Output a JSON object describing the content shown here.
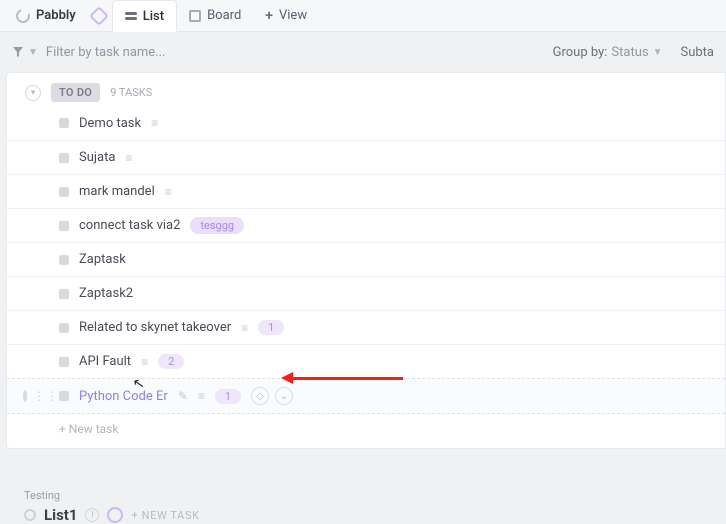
{
  "brand": "Pabbly",
  "tabs": {
    "list": "List",
    "board": "Board",
    "view": "View"
  },
  "filter": {
    "placeholder": "Filter by task name..."
  },
  "groupby": {
    "label": "Group by:",
    "value": "Status"
  },
  "rightcut": "Subta",
  "section": {
    "status": "TO DO",
    "count": "9 TASKS"
  },
  "tasks": [
    {
      "name": "Demo task",
      "trailing": "desc"
    },
    {
      "name": "Sujata",
      "trailing": "desc"
    },
    {
      "name": "mark mandel",
      "trailing": "desc"
    },
    {
      "name": "connect task via2",
      "trailing": "tag",
      "tag": "tesggg"
    },
    {
      "name": "Zaptask"
    },
    {
      "name": "Zaptask2"
    },
    {
      "name": "Related to skynet takeover",
      "trailing": "num+desc",
      "num": "1"
    },
    {
      "name": "API Fault",
      "trailing": "num+desc",
      "num": "2"
    },
    {
      "name": "Python Code Er",
      "hover": true,
      "trailing": "hover",
      "num": "1"
    }
  ],
  "newtask": "+ New task",
  "bottom": {
    "group": "Testing",
    "list": "List1",
    "newtask": "+ NEW TASK"
  }
}
